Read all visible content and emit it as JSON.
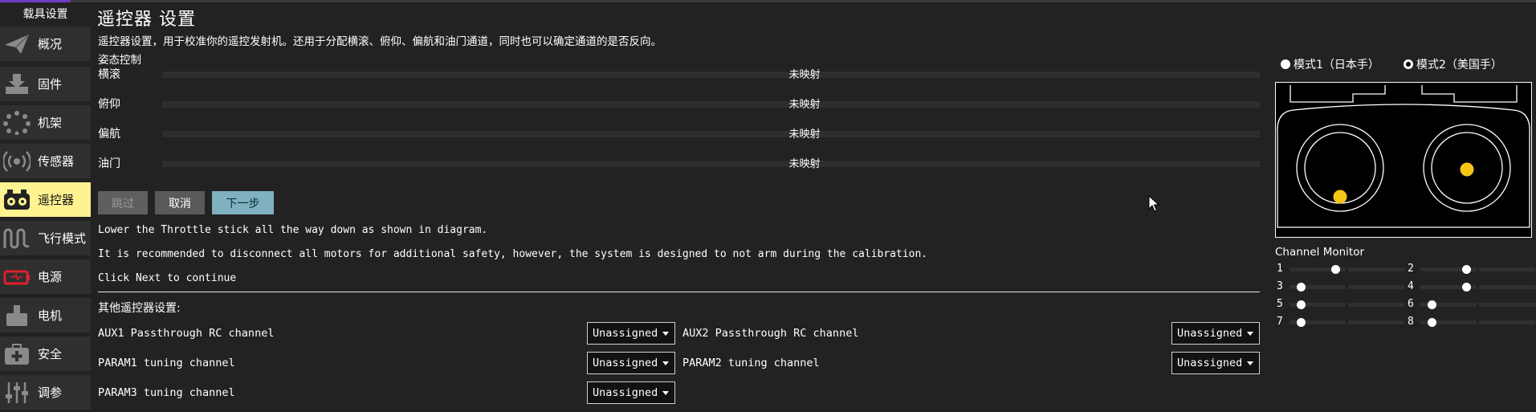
{
  "sidebar": {
    "title": "载具设置",
    "items": [
      {
        "label": "概况",
        "icon": "paper-plane-icon"
      },
      {
        "label": "固件",
        "icon": "download-icon"
      },
      {
        "label": "机架",
        "icon": "airframe-icon"
      },
      {
        "label": "传感器",
        "icon": "radio-waves-icon"
      },
      {
        "label": "遥控器",
        "icon": "rc-transmitter-icon",
        "active": true
      },
      {
        "label": "飞行模式",
        "icon": "wave-icon"
      },
      {
        "label": "电源",
        "icon": "battery-icon"
      },
      {
        "label": "电机",
        "icon": "motor-icon"
      },
      {
        "label": "安全",
        "icon": "first-aid-icon"
      },
      {
        "label": "调参",
        "icon": "sliders-icon"
      }
    ]
  },
  "main": {
    "title": "遥控器 设置",
    "description": "遥控器设置，用于校准你的遥控发射机。还用于分配横滚、俯仰、偏航和油门通道，同时也可以确定通道的是否反向。",
    "section_label": "姿态控制",
    "axes": [
      {
        "name": "横滚",
        "status": "未映射"
      },
      {
        "name": "俯仰",
        "status": "未映射"
      },
      {
        "name": "偏航",
        "status": "未映射"
      },
      {
        "name": "油门",
        "status": "未映射"
      }
    ],
    "buttons": {
      "skip": "跳过",
      "cancel": "取消",
      "next": "下一步"
    },
    "instructions": [
      "Lower the Throttle stick all the way down as shown in diagram.",
      "It is recommended to disconnect all motors for additional safety, however, the system is designed to not arm during the calibration.",
      "Click Next to continue"
    ],
    "other_title": "其他遥控器设置:",
    "params": [
      {
        "label": "AUX1 Passthrough RC channel",
        "value": "Unassigned"
      },
      {
        "label": "AUX2 Passthrough RC channel",
        "value": "Unassigned"
      },
      {
        "label": "PARAM1 tuning channel",
        "value": "Unassigned"
      },
      {
        "label": "PARAM2 tuning channel",
        "value": "Unassigned"
      },
      {
        "label": "PARAM3 tuning channel",
        "value": "Unassigned"
      }
    ]
  },
  "right": {
    "mode1_label": "模式1（日本手）",
    "mode2_label": "模式2（美国手）",
    "selected_mode": 2,
    "stick_color": "#f5c518",
    "channel_monitor_title": "Channel Monitor",
    "channels": [
      {
        "num": "1",
        "level": 0.4
      },
      {
        "num": "2",
        "level": 0.4
      },
      {
        "num": "3",
        "level": 0.1
      },
      {
        "num": "4",
        "level": 0.4
      },
      {
        "num": "5",
        "level": 0.1
      },
      {
        "num": "6",
        "level": 0.1
      },
      {
        "num": "7",
        "level": 0.1
      },
      {
        "num": "8",
        "level": 0.1
      }
    ]
  }
}
